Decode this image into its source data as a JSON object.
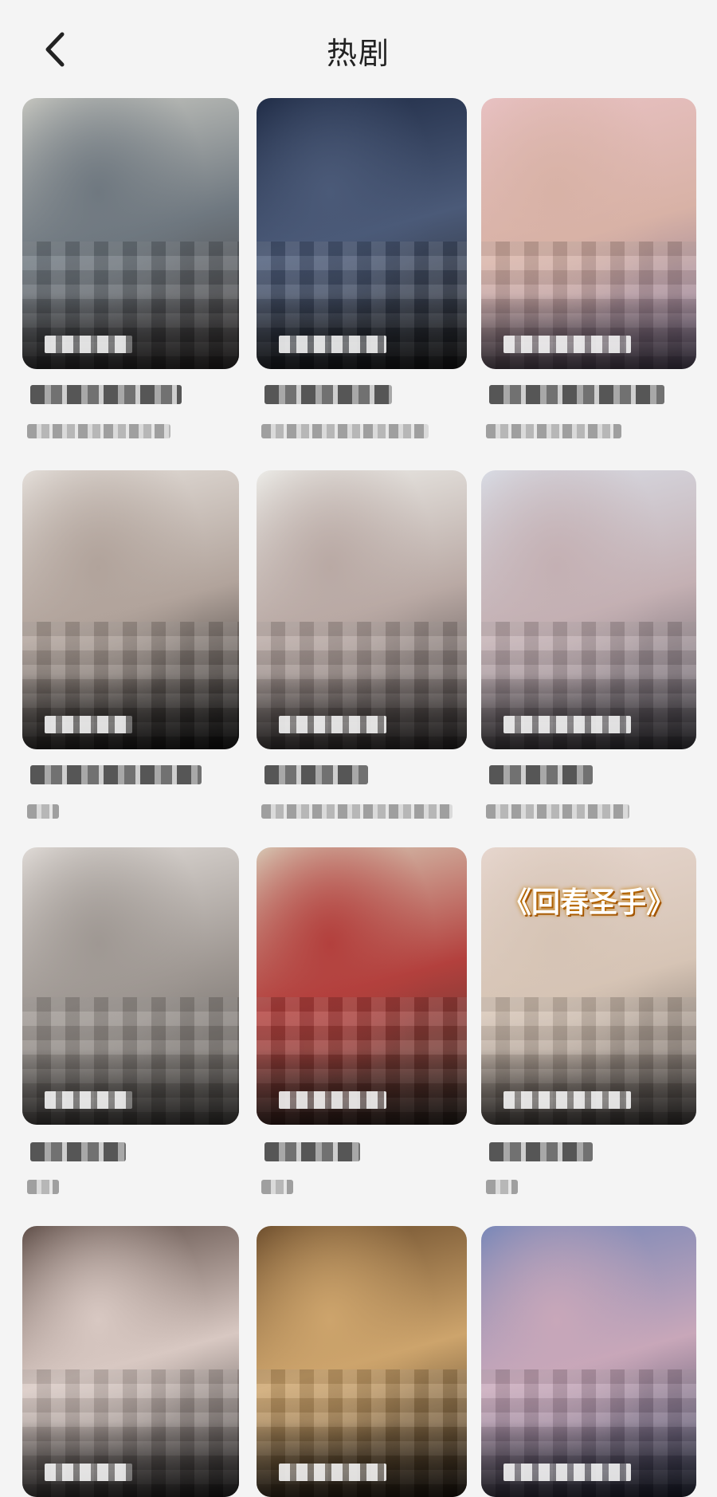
{
  "header": {
    "title": "热剧",
    "back_icon": "chevron-left-icon"
  },
  "cards": [
    {
      "cover_colors": [
        "#c9c9c2",
        "#6f7880",
        "#3a3433"
      ]
    },
    {
      "cover_colors": [
        "#1e2a44",
        "#4b5a78",
        "#222222"
      ]
    },
    {
      "cover_colors": [
        "#e9c2c4",
        "#d8b2a6",
        "#7a6a8c"
      ]
    },
    {
      "cover_colors": [
        "#e6e1dc",
        "#b1a39b",
        "#151515"
      ]
    },
    {
      "cover_colors": [
        "#eeeeea",
        "#b9a9a4",
        "#3f3a3a"
      ]
    },
    {
      "cover_colors": [
        "#d9dde6",
        "#c4b0b3",
        "#4f4c56"
      ]
    },
    {
      "cover_colors": [
        "#e2ddd9",
        "#9f9893",
        "#5d5955"
      ]
    },
    {
      "cover_colors": [
        "#d8ccb8",
        "#b3403d",
        "#3f352c"
      ]
    },
    {
      "cover_colors": [
        "#e7d7cf",
        "#d6c4b5",
        "#5b5552"
      ],
      "banner": "《回春圣手》"
    },
    {
      "cover_colors": [
        "#5b4a44",
        "#d8c8c2",
        "#2c2a2a"
      ]
    },
    {
      "cover_colors": [
        "#6a4b2b",
        "#cda46c",
        "#2d2216"
      ]
    },
    {
      "cover_colors": [
        "#7586b8",
        "#c8a7b9",
        "#2e3551"
      ]
    }
  ]
}
